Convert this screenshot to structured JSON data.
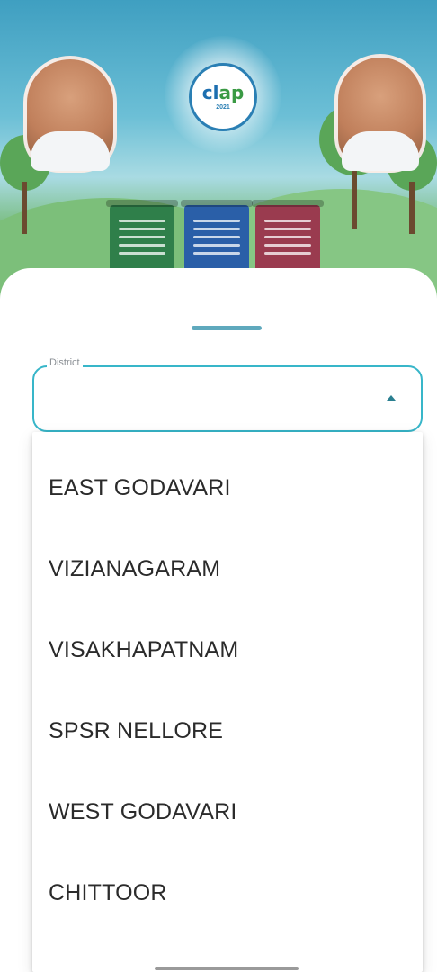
{
  "banner": {
    "logo_text": "cl",
    "logo_text_accent": "ap",
    "logo_subtext": "2021"
  },
  "district_field": {
    "label": "District",
    "value": "",
    "state": "expanded"
  },
  "district_options": [
    "EAST GODAVARI",
    "VIZIANAGARAM",
    "VISAKHAPATNAM",
    "SPSR NELLORE",
    "WEST GODAVARI",
    "CHITTOOR"
  ],
  "colors": {
    "accent": "#38b6c9",
    "handle": "#5fa9bd",
    "text": "#2b2b2b",
    "label": "#8a8f94"
  }
}
